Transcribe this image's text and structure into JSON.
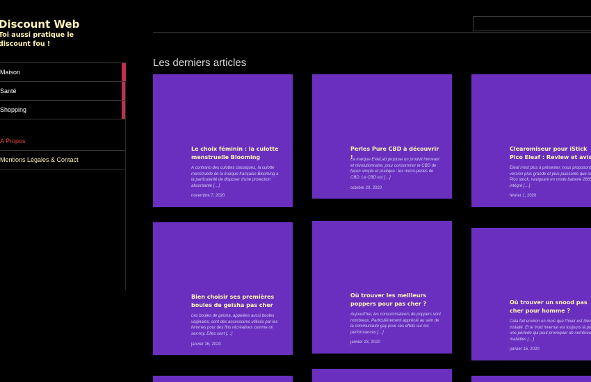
{
  "site": {
    "title": "Discount Web",
    "tagline": "Toi aussi pratique le discount fou !"
  },
  "nav": {
    "items": [
      {
        "label": "Maison"
      },
      {
        "label": "Santé"
      },
      {
        "label": "Shopping"
      }
    ]
  },
  "secondary_nav": {
    "items": [
      {
        "label": "A Propos"
      },
      {
        "label": "Mentions Légales & Contact"
      }
    ]
  },
  "main": {
    "heading": "Les derniers articles"
  },
  "articles": [
    {
      "title": "Le choix féminin : la culotte menstruelle Blooming",
      "excerpt": "A contrario des culottes classiques, la culotte menstruelle de la marque française Blooming a la particularité de disposer d'une protection absorbante […]",
      "date": "novembre 7, 2020"
    },
    {
      "title": "Perles Pure CBD à découvrir !",
      "excerpt": "La marque EvieLab propose un produit innovant et révolutionnaire, pour consommer le CBD de façon simple et pratique : les micro-perles de CBD. Le CBD est […]",
      "date": "octobre 20, 2020"
    },
    {
      "title": "Clearomiseur pour iStick Pico Eleaf : Review et avis",
      "excerpt": "Eleaf n'est plus à présenter, nous proposons une version plus grande et plus puissante que son Pico stock, naviguant en mode batterie 26650 intégré […]",
      "date": "février 1, 2020"
    },
    {
      "title": "Bien choisir ses premières boules de geisha pas cher",
      "excerpt": "Les boules de geisha, appelées aussi boules vaginales, sont des accessoires utilisés par les femmes pour des fins récréatives comme un sex-toy. Elles sont […]",
      "date": "janvier 16, 2020"
    },
    {
      "title": "Où trouver les meilleurs poppers pour pas cher ?",
      "excerpt": "Aujourd'hui, les consommateurs de poppers sont nombreux. Particulièrement apprécié au sein de la communauté gay pour ses effets sur les performances […]",
      "date": "janvier 23, 2020"
    },
    {
      "title": "Où trouver un snood pas cher pour homme ?",
      "excerpt": "Cela fait environ un mois que l'hiver est bien installé. Et le froid hivernal est toujours là pour une période qui peut provoquer de nombreuses maladies […]",
      "date": "janvier 16, 2020"
    }
  ]
}
